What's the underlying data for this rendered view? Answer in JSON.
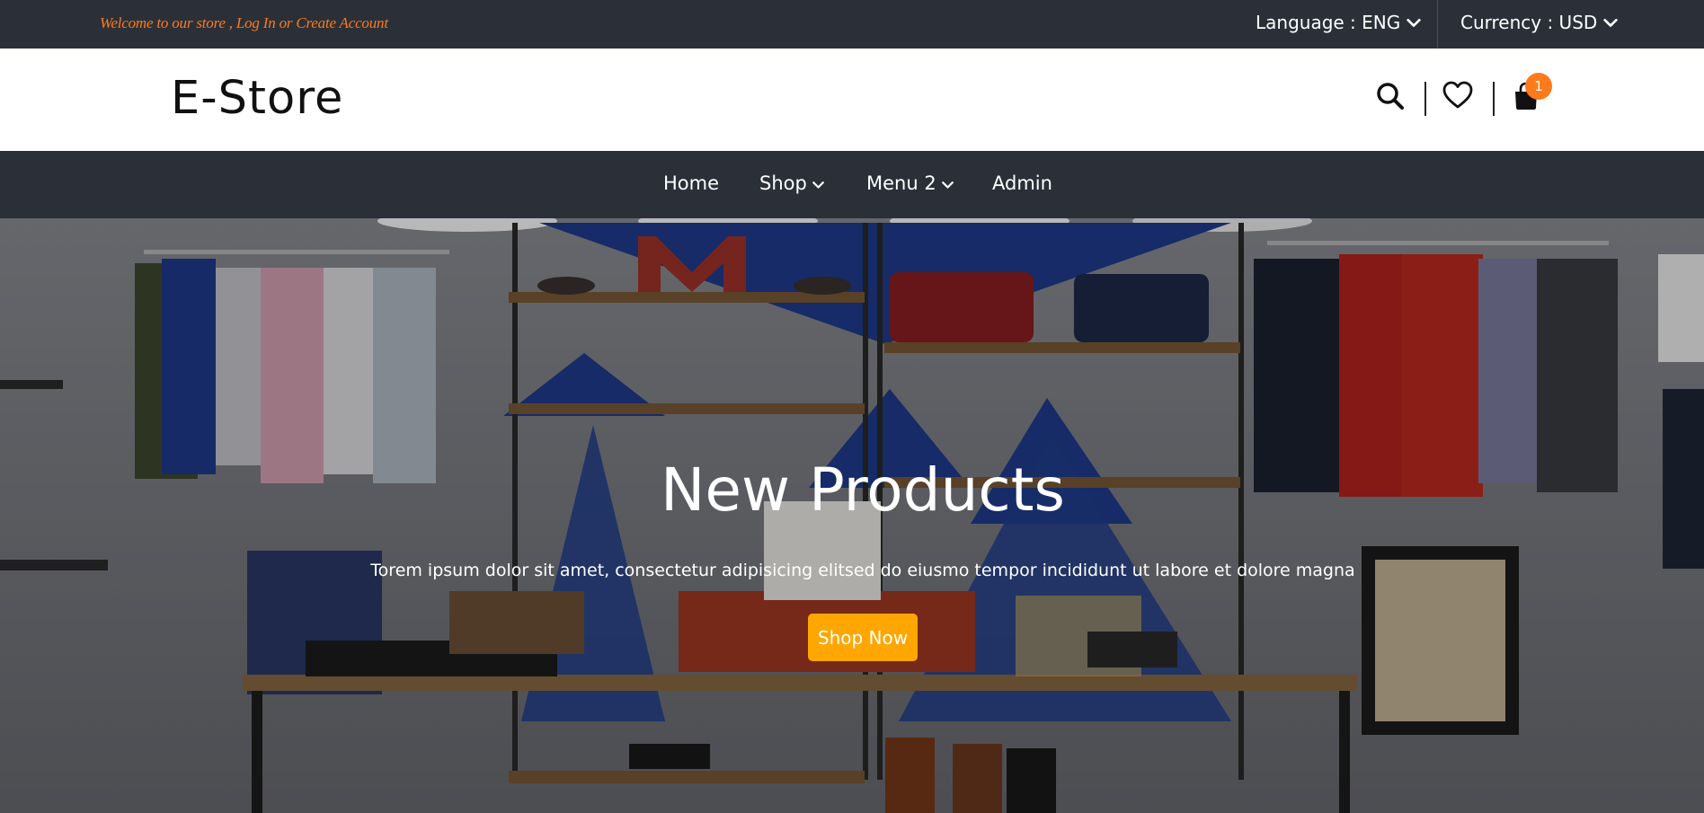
{
  "topbar": {
    "welcome_text": "Welcome to our store ,",
    "login_label": "Log In",
    "or_text": "or",
    "create_account_label": "Create Account",
    "language_label": "Language : ENG",
    "currency_label": "Currency : USD"
  },
  "header": {
    "logo": "E-Store",
    "cart_count": "1",
    "icons": [
      "search-icon",
      "heart-icon",
      "shopping-bag-icon"
    ]
  },
  "nav": {
    "items": [
      {
        "label": "Home",
        "has_dropdown": false
      },
      {
        "label": "Shop",
        "has_dropdown": true
      },
      {
        "label": "Menu 2",
        "has_dropdown": true
      },
      {
        "label": "Admin",
        "has_dropdown": false
      }
    ]
  },
  "hero": {
    "title": "New Products",
    "subtitle": "Torem ipsum dolor sit amet, consectetur adipisicing elitsed do eiusmo tempor incididunt ut labore et dolore magna",
    "button_label": "Shop Now"
  },
  "colors": {
    "dark_bar": "#2b3038",
    "accent_orange": "#ff7a1a",
    "button_yellow": "#ffa600",
    "white": "#ffffff"
  }
}
